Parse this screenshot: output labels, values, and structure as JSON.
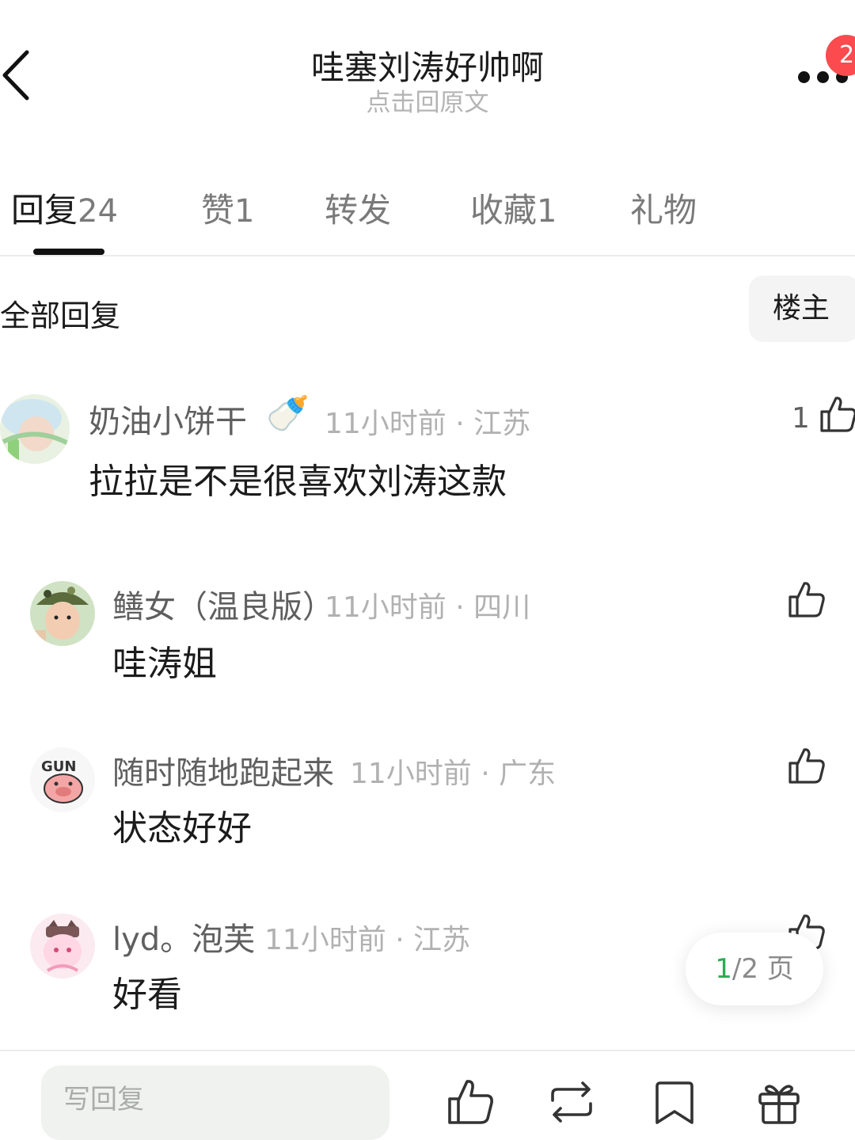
{
  "header": {
    "title": "哇塞刘涛好帅啊",
    "subtitle": "点击回原文",
    "notification_count": "2",
    "back_icon": "chevron-left-icon",
    "more_icon": "more-dots-icon"
  },
  "tabs": [
    {
      "label": "回复",
      "count": "24",
      "active": true
    },
    {
      "label": "赞",
      "count": "1"
    },
    {
      "label": "转发",
      "count": ""
    },
    {
      "label": "收藏",
      "count": "1"
    },
    {
      "label": "礼物",
      "count": ""
    }
  ],
  "filter": {
    "section_title": "全部回复",
    "owner_button": "楼主"
  },
  "comments": [
    {
      "username": "奶油小饼干",
      "emoji": "🍼",
      "time": "11小时前",
      "location": "江苏",
      "meta": "11小时前 · 江苏",
      "text": "拉拉是不是很喜欢刘涛这款",
      "likes": "1"
    },
    {
      "username": "鳝女（温良版）",
      "time": "11小时前",
      "location": "四川",
      "meta": "11小时前 · 四川",
      "text": "哇涛姐",
      "likes": ""
    },
    {
      "username": "随时随地跑起来",
      "time": "11小时前",
      "location": "广东",
      "meta": "11小时前 · 广东",
      "text": "状态好好",
      "likes": ""
    },
    {
      "username": "lyd。泡芙",
      "time": "11小时前",
      "location": "江苏",
      "meta": "11小时前 · 江苏",
      "text": "好看",
      "likes": ""
    }
  ],
  "pager": {
    "current": "1",
    "rest": "/2 页"
  },
  "bottom_bar": {
    "reply_placeholder": "写回复",
    "icons": [
      "thumbs-up-icon",
      "repost-icon",
      "bookmark-icon",
      "gift-icon"
    ]
  },
  "colors": {
    "accent_green": "#2bab52",
    "badge_red": "#fb4b4f",
    "muted_text": "#b1b1b1"
  }
}
